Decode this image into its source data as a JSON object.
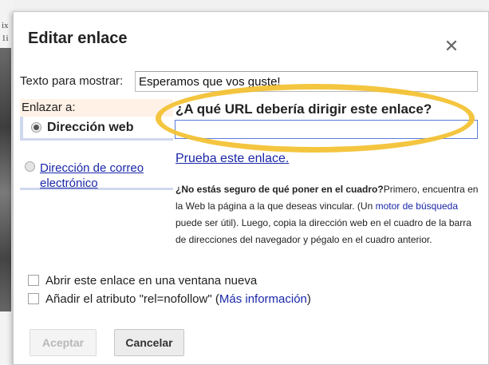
{
  "background": {
    "fragments": [
      "ix",
      "1i"
    ]
  },
  "dialog": {
    "title": "Editar enlace",
    "close_glyph": "✕",
    "text_to_display_label": "Texto para mostrar:",
    "text_to_display_value": "Esperamos que vos guste!",
    "link_to_label": "Enlazar a:",
    "link_options": [
      {
        "label": "Dirección web",
        "selected": true
      },
      {
        "label": "Dirección de correo electrónico",
        "selected": false
      }
    ],
    "url_heading": "¿A qué URL debería dirigir este enlace?",
    "url_value": "",
    "test_link": "Prueba este enlace.",
    "help": {
      "bold": "¿No estás seguro de qué poner en el cuadro?",
      "part1": "Primero, encuentra en la Web la página a la que deseas vincular. (Un ",
      "link": "motor de búsqueda",
      "part2": " puede ser útil). Luego, copia la dirección web en el cuadro de la barra de direcciones del navegador y pégalo en el cuadro anterior."
    },
    "checkboxes": [
      {
        "label": "Abrir este enlace en una ventana nueva",
        "checked": false
      },
      {
        "label": "Añadir el atributo \"rel=nofollow\" (",
        "link": "Más información",
        "suffix": ")",
        "checked": false
      }
    ],
    "buttons": {
      "ok": "Aceptar",
      "cancel": "Cancelar"
    },
    "colors": {
      "link": "#1a27a8",
      "highlight": "#f3c02f",
      "link_to_bg": "#fff1e6"
    }
  }
}
